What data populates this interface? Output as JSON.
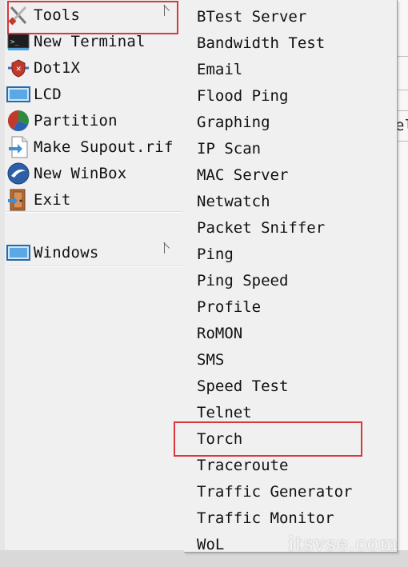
{
  "left_menu": {
    "items": [
      {
        "label": "Tools",
        "icon": "tools-icon",
        "has_submenu": true
      },
      {
        "label": "New Terminal",
        "icon": "terminal-icon"
      },
      {
        "label": "Dot1X",
        "icon": "dot1x-icon"
      },
      {
        "label": "LCD",
        "icon": "lcd-icon"
      },
      {
        "label": "Partition",
        "icon": "partition-icon"
      },
      {
        "label": "Make Supout.rif",
        "icon": "supout-icon"
      },
      {
        "label": "New WinBox",
        "icon": "winbox-icon"
      },
      {
        "label": "Exit",
        "icon": "exit-icon"
      }
    ],
    "windows": {
      "label": "Windows",
      "icon": "windows-icon",
      "has_submenu": true
    }
  },
  "submenu": {
    "items": [
      "BTest Server",
      "Bandwidth Test",
      "Email",
      "Flood Ping",
      "Graphing",
      "IP Scan",
      "MAC Server",
      "Netwatch",
      "Packet Sniffer",
      "Ping",
      "Ping Speed",
      "Profile",
      "RoMON",
      "SMS",
      "Speed Test",
      "Telnet",
      "Torch",
      "Traceroute",
      "Traffic Generator",
      "Traffic Monitor",
      "WoL"
    ],
    "selected": "Torch"
  },
  "background": {
    "partial_text": "el"
  },
  "watermark": "itsvse.com",
  "colors": {
    "highlight": "#d9363e",
    "menu_bg": "#f0f0f0"
  }
}
